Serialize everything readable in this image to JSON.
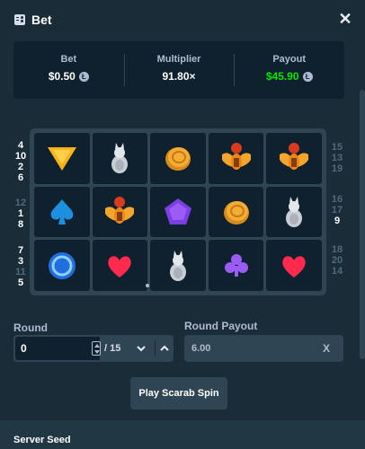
{
  "header": {
    "title": "Bet",
    "title_icon": "bet-slip-icon",
    "close_icon": "close-icon",
    "close_glyph": "✕"
  },
  "stats": {
    "bet": {
      "label": "Bet",
      "value": "$0.50",
      "currency_icon": "litecoin-icon"
    },
    "multiplier": {
      "label": "Multiplier",
      "value": "91.80×"
    },
    "payout": {
      "label": "Payout",
      "value": "$45.90",
      "currency_icon": "litecoin-icon",
      "color": "#00e701"
    }
  },
  "currency_glyph": "Ł",
  "paylines": {
    "left_top": [
      "4",
      "10",
      "2",
      "6"
    ],
    "left_middle": [
      "12",
      "1",
      "8"
    ],
    "left_bottom": [
      "7",
      "3",
      "11",
      "5"
    ],
    "right_top": [
      "15",
      "13",
      "19"
    ],
    "right_middle": [
      "16",
      "17",
      "9"
    ],
    "right_bottom": [
      "18",
      "20",
      "14"
    ]
  },
  "reels": [
    [
      "triangle",
      "cat",
      "coin",
      "scarab",
      "scarab"
    ],
    [
      "spade",
      "scarab",
      "pentagon",
      "coin",
      "cat"
    ],
    [
      "ring",
      "heart",
      "cat",
      "club",
      "heart"
    ]
  ],
  "round": {
    "label": "Round",
    "value": "0",
    "total": "/ 15"
  },
  "round_payout": {
    "label": "Round Payout",
    "value": "6.00",
    "clear": "X"
  },
  "play_button": "Play Scarab Spin",
  "server_seed": {
    "label": "Server Seed"
  }
}
